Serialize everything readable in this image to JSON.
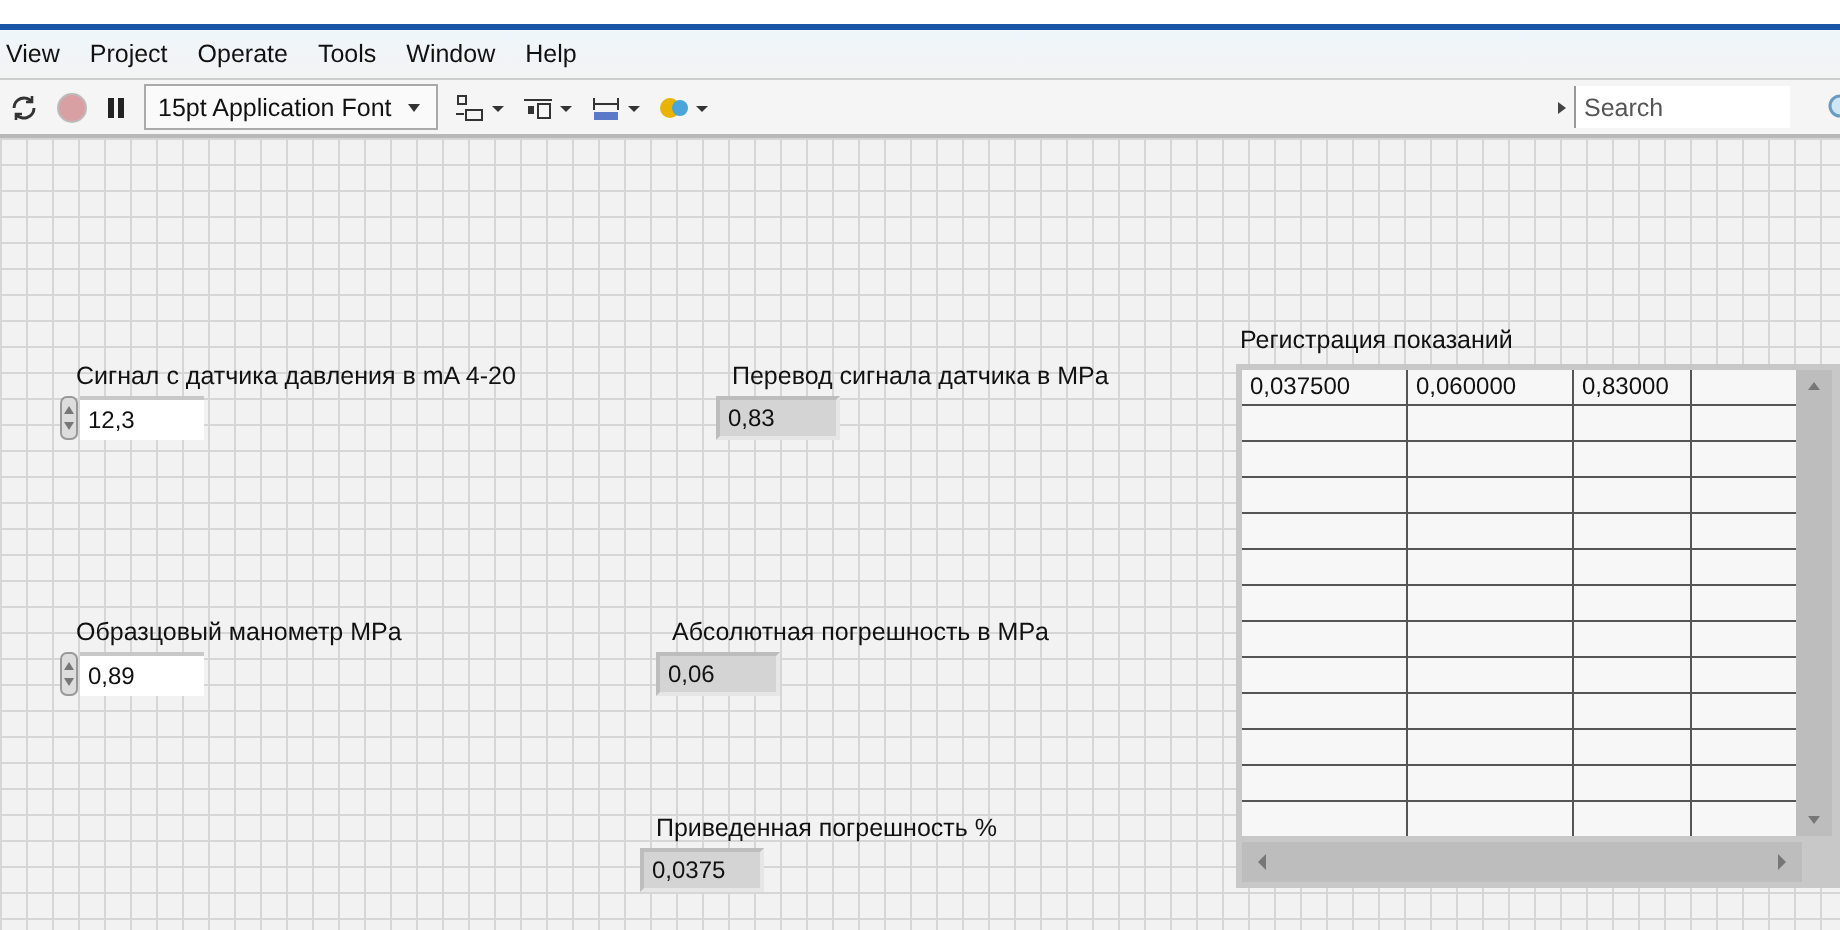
{
  "menu": [
    "View",
    "Project",
    "Operate",
    "Tools",
    "Window",
    "Help"
  ],
  "toolbar": {
    "font": "15pt Application Font",
    "search": {
      "placeholder": "Search"
    }
  },
  "controls": [
    {
      "kind": "control",
      "label": "Сигнал с датчика давления в mA 4-20",
      "value": "12,3"
    },
    {
      "kind": "indicator",
      "label": "Перевод сигнала датчика в MPa",
      "value": "0,83"
    },
    {
      "kind": "control",
      "label": "Образцовый манометр MPa",
      "value": "0,89"
    },
    {
      "kind": "indicator",
      "label": "Абсолютная погрешность в MPa",
      "value": "0,06"
    },
    {
      "kind": "indicator",
      "label": "Приведенная погрешность %",
      "value": "0,0375"
    }
  ],
  "table": {
    "label": "Регистрация показаний",
    "rows": [
      [
        "0,037500",
        "0,060000",
        "0,83000"
      ]
    ]
  }
}
